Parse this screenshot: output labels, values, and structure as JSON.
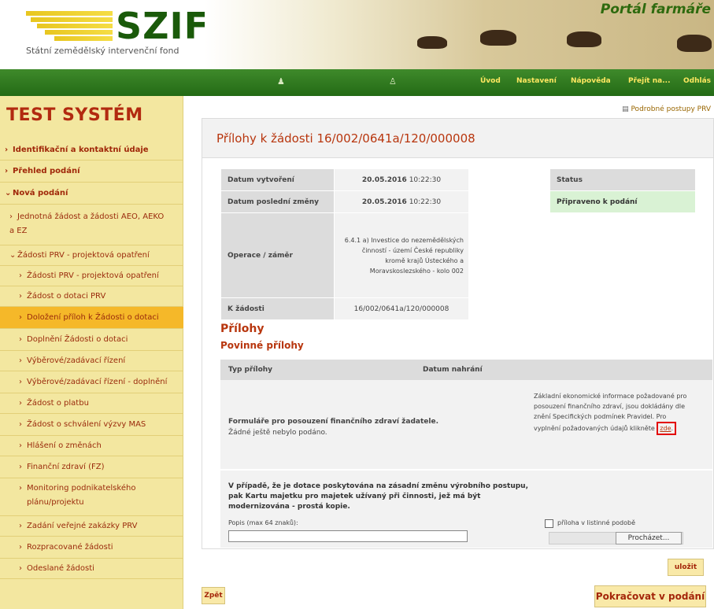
{
  "header": {
    "logo_text": "SZIF",
    "logo_subtitle": "Státní zemědělský intervenční fond",
    "portal_title": "Portál farmáře"
  },
  "nav": {
    "items": [
      "Úvod",
      "Nastavení",
      "Nápověda",
      "Přejít na...",
      "Odhlás"
    ]
  },
  "sidebar": {
    "title": "TEST SYSTÉM",
    "items": [
      {
        "label": "Identifikační a kontaktní údaje",
        "marker": "›"
      },
      {
        "label": "Přehled podání",
        "marker": "›"
      },
      {
        "label": "Nová podání",
        "marker": "⌄"
      },
      {
        "label": "Jednotná žádost a žádosti AEO, AEKO",
        "label2": "a EZ",
        "marker": "›"
      },
      {
        "label": "Žádosti PRV - projektová opatření",
        "marker": "⌄"
      },
      {
        "label": "Žádosti PRV - projektová opatření",
        "marker": "›"
      },
      {
        "label": "Žádost o dotaci PRV",
        "marker": "›"
      },
      {
        "label": "Doložení příloh k Žádosti o dotaci",
        "marker": "›"
      },
      {
        "label": "Doplnění Žádosti o dotaci",
        "marker": "›"
      },
      {
        "label": "Výběrové/zadávací řízení",
        "marker": "›"
      },
      {
        "label": "Výběrové/zadávací řízení - doplnění",
        "marker": "›"
      },
      {
        "label": "Žádost o platbu",
        "marker": "›"
      },
      {
        "label": "Žádost o schválení výzvy MAS",
        "marker": "›"
      },
      {
        "label": "Hlášení o změnách",
        "marker": "›"
      },
      {
        "label": "Finanční zdraví (FZ)",
        "marker": "›"
      },
      {
        "label": "Monitoring podnikatelského",
        "label2": "plánu/projektu",
        "marker": "›"
      },
      {
        "label": "Zadání veřejné zakázky PRV",
        "marker": "›"
      },
      {
        "label": "Rozpracované žádosti",
        "marker": "›"
      },
      {
        "label": "Odeslané žádosti",
        "marker": "›"
      }
    ]
  },
  "main": {
    "ext_link": "Podrobné postupy PRV",
    "title": "Přílohy k žádosti 16/002/0641a/120/000008",
    "info": {
      "created_label": "Datum vytvoření",
      "created_date": "20.05.2016",
      "created_time": "10:22:30",
      "modified_label": "Datum poslední změny",
      "modified_date": "20.05.2016",
      "modified_time": "10:22:30",
      "operation_label": "Operace / záměr",
      "operation_value": "6.4.1 a) Investice do nezemědělských činností - území České republiky kromě krajů Ústeckého a Moravskoslezského - kolo 002",
      "request_label": "K žádosti",
      "request_value": "16/002/0641a/120/000008",
      "status_label": "Status",
      "status_value": "Připraveno k podání"
    },
    "attachments_title": "Přílohy",
    "required_title": "Povinné přílohy",
    "table_head": {
      "type": "Typ přílohy",
      "date": "Datum nahrání"
    },
    "row1": {
      "name": "Formuláře pro posouzení finančního zdraví žadatele.",
      "status": "Žádné ještě nebylo podáno.",
      "desc": "Základní ekonomické informace požadované pro posouzení finančního zdraví, jsou dokládány dle znění Specifických podmínek Pravidel. Pro vyplnění požadovaných údajů klikněte",
      "link": "zde",
      "link_tail": "."
    },
    "row2": {
      "name": "V případě, že je dotace poskytována na zásadní změnu výrobního postupu, pak Kartu majetku pro majetek užívaný při činnosti, jež má být modernizována - prostá kopie.",
      "input_label": "Popis (max 64 znaků):",
      "input_value": "",
      "checkbox_label": "příloha v listinné podobě",
      "browse_label": "Procházet..."
    },
    "save_button": "uložit",
    "back_button": "Zpět",
    "continue_button": "Pokračovat v podání"
  },
  "colors": {
    "accent": "#b8360e",
    "nav_green": "#2e7a1e",
    "sidebar_bg": "#f3e7a0",
    "highlight": "#e30000",
    "status_bg": "#d9f2d4"
  }
}
